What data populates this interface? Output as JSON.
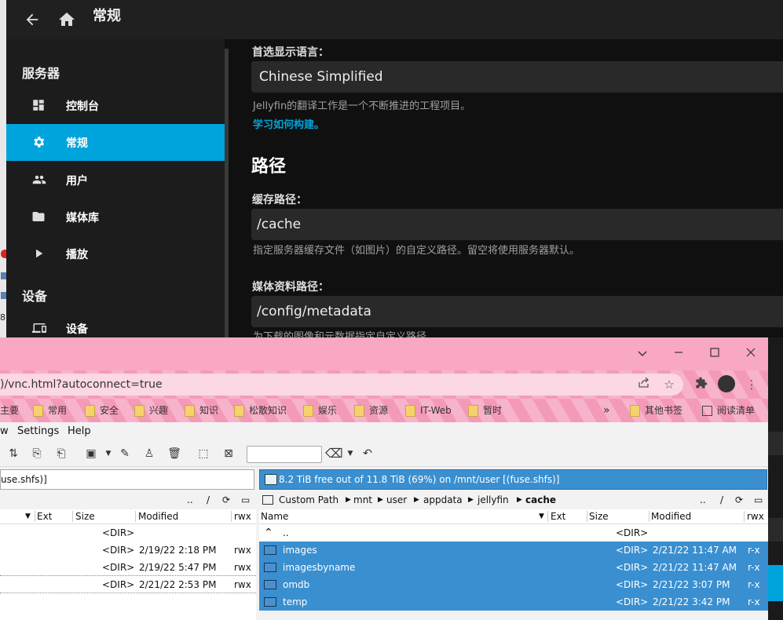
{
  "jellyfin": {
    "header": {
      "title": "常规"
    },
    "sidebar": {
      "section_server": "服务器",
      "items": [
        {
          "label": "控制台",
          "icon": "dashboard-icon"
        },
        {
          "label": "常规",
          "icon": "gear-icon",
          "active": true
        },
        {
          "label": "用户",
          "icon": "people-icon"
        },
        {
          "label": "媒体库",
          "icon": "folder-icon"
        },
        {
          "label": "播放",
          "icon": "play-icon"
        }
      ],
      "section_devices": "设备",
      "device_item": {
        "label": "设备",
        "icon": "devices-icon"
      }
    },
    "content": {
      "language_label": "首选显示语言：",
      "language_value": "Chinese Simplified",
      "language_help": "Jellyfin的翻译工作是一个不断推进的工程项目。",
      "language_link": "学习如何构建。",
      "paths_heading": "路径",
      "cache_label": "缓存路径：",
      "cache_value": "/cache",
      "cache_help": "指定服务器缓存文件（如图片）的自定义路径。留空将使用服务器默认。",
      "metadata_label": "媒体资料路径：",
      "metadata_value": "/config/metadata",
      "metadata_help": "为下载的图像和元数据指定自定义路径。"
    },
    "left_strip_text": "8"
  },
  "browser": {
    "url": ")/vnc.html?autoconnect=true",
    "bookmarks": [
      {
        "label": "主要",
        "folder": false
      },
      {
        "label": "常用",
        "folder": true
      },
      {
        "label": "安全",
        "folder": true
      },
      {
        "label": "兴趣",
        "folder": true
      },
      {
        "label": "知识",
        "folder": true
      },
      {
        "label": "松散知识",
        "folder": true
      },
      {
        "label": "娱乐",
        "folder": true
      },
      {
        "label": "资源",
        "folder": true
      },
      {
        "label": "IT-Web",
        "folder": true
      },
      {
        "label": "暂时",
        "folder": true
      }
    ],
    "more_bookmarks": "»",
    "other_bookmarks": "其他书签",
    "reading_list": "阅读清单"
  },
  "commander": {
    "menu": {
      "view_partial": "w",
      "settings": "Settings",
      "help": "Help"
    },
    "left": {
      "drive_text": "use.shfs)]",
      "path_up": "..",
      "path_root": "/",
      "columns": {
        "ext": "Ext",
        "size": "Size",
        "modified": "Modified",
        "attr": "rwx"
      },
      "rows": [
        {
          "size": "<DIR>",
          "modified": "",
          "attr": ""
        },
        {
          "size": "<DIR>",
          "modified": "2/19/22 2:18 PM",
          "attr": "rwx"
        },
        {
          "size": "<DIR>",
          "modified": "2/19/22 5:47 PM",
          "attr": "rwx"
        },
        {
          "size": "<DIR>",
          "modified": "2/21/22 2:53 PM",
          "attr": "rwx"
        }
      ]
    },
    "right": {
      "drive_text": "8.2 TiB free out of 11.8 TiB (69%) on /mnt/user [(fuse.shfs)]",
      "path": [
        "Custom Path",
        "mnt",
        "user",
        "appdata",
        "jellyfin",
        "cache"
      ],
      "path_up": "..",
      "path_root": "/",
      "columns": {
        "name": "Name",
        "ext": "Ext",
        "size": "Size",
        "modified": "Modified",
        "attr": "rwx"
      },
      "rows": [
        {
          "name": "..",
          "size": "<DIR>",
          "modified": "",
          "attr": "",
          "selected": false
        },
        {
          "name": "images",
          "size": "<DIR>",
          "modified": "2/21/22 11:47 AM",
          "attr": "r-x",
          "selected": true
        },
        {
          "name": "imagesbyname",
          "size": "<DIR>",
          "modified": "2/21/22 11:47 AM",
          "attr": "r-x",
          "selected": true
        },
        {
          "name": "omdb",
          "size": "<DIR>",
          "modified": "2/21/22 3:07 PM",
          "attr": "r-x",
          "selected": true
        },
        {
          "name": "temp",
          "size": "<DIR>",
          "modified": "2/21/22 3:42 PM",
          "attr": "r-x",
          "selected": true
        }
      ]
    }
  }
}
